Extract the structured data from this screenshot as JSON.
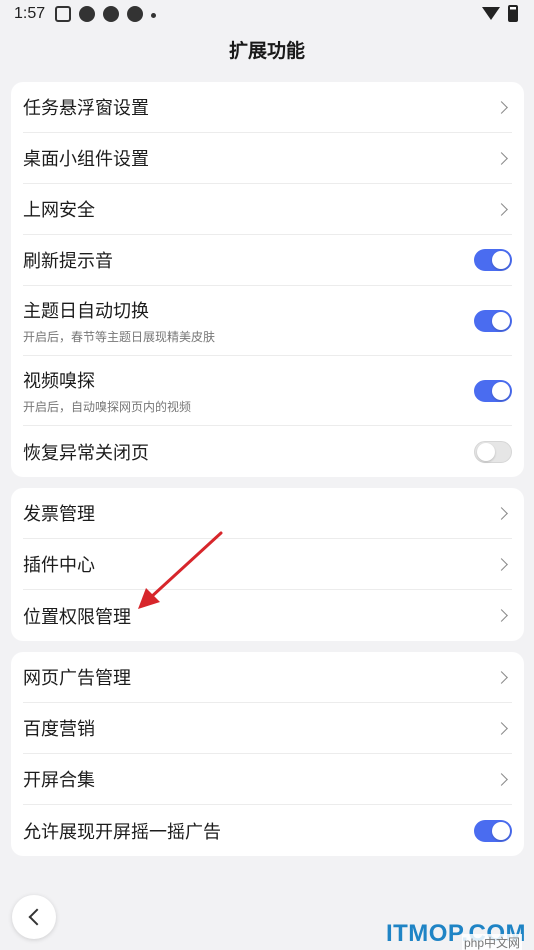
{
  "status_bar": {
    "time": "1:57"
  },
  "page": {
    "title": "扩展功能"
  },
  "group1": [
    {
      "label": "任务悬浮窗设置",
      "control": "chevron"
    },
    {
      "label": "桌面小组件设置",
      "control": "chevron"
    },
    {
      "label": "上网安全",
      "control": "chevron"
    },
    {
      "label": "刷新提示音",
      "control": "toggle",
      "on": true
    },
    {
      "label": "主题日自动切换",
      "sub": "开启后，春节等主题日展现精美皮肤",
      "control": "toggle",
      "on": true
    },
    {
      "label": "视频嗅探",
      "sub": "开启后，自动嗅探网页内的视频",
      "control": "toggle",
      "on": true
    },
    {
      "label": "恢复异常关闭页",
      "control": "toggle",
      "on": false
    }
  ],
  "group2": [
    {
      "label": "发票管理",
      "control": "chevron"
    },
    {
      "label": "插件中心",
      "control": "chevron"
    },
    {
      "label": "位置权限管理",
      "control": "chevron"
    }
  ],
  "group3": [
    {
      "label": "网页广告管理",
      "control": "chevron"
    },
    {
      "label": "百度营销",
      "control": "chevron"
    },
    {
      "label": "开屏合集",
      "control": "chevron"
    },
    {
      "label": "允许展现开屏摇一摇广告",
      "control": "toggle",
      "on": true
    }
  ],
  "watermark": {
    "main": "ITMOP.COM",
    "small": "php中文网"
  },
  "colors": {
    "accent": "#4a6cf0",
    "annotation_arrow": "#d7262b"
  }
}
